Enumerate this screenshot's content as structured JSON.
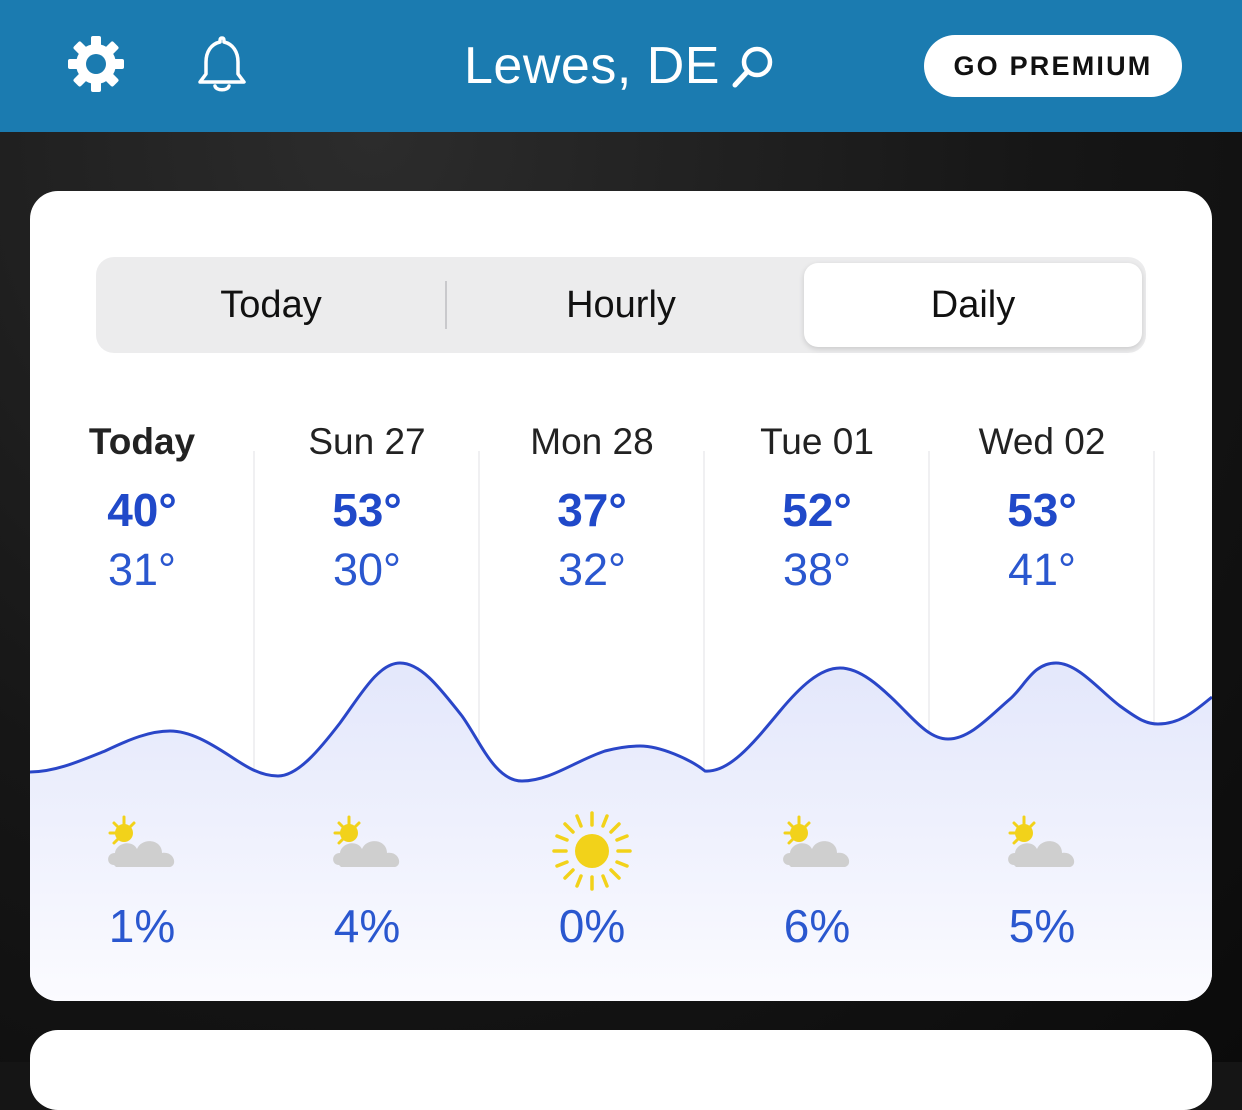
{
  "header": {
    "location": "Lewes, DE",
    "premium_label": "GO PREMIUM",
    "icons": [
      "gear-icon",
      "bell-icon",
      "search-icon"
    ]
  },
  "tabs": [
    {
      "label": "Today",
      "selected": false
    },
    {
      "label": "Hourly",
      "selected": false
    },
    {
      "label": "Daily",
      "selected": true
    }
  ],
  "days": [
    {
      "label": "Today",
      "high": "40°",
      "low": "31°",
      "icon": "partly-cloudy-icon",
      "precip": "1%"
    },
    {
      "label": "Sun 27",
      "high": "53°",
      "low": "30°",
      "icon": "partly-cloudy-icon",
      "precip": "4%"
    },
    {
      "label": "Mon 28",
      "high": "37°",
      "low": "32°",
      "icon": "sunny-icon",
      "precip": "0%"
    },
    {
      "label": "Tue 01",
      "high": "52°",
      "low": "38°",
      "icon": "partly-cloudy-icon",
      "precip": "6%"
    },
    {
      "label": "Wed 02",
      "high": "53°",
      "low": "41°",
      "icon": "partly-cloudy-icon",
      "precip": "5%"
    }
  ],
  "colors": {
    "header_bg": "#1b7bb0",
    "temp_high": "#2049c9",
    "temp_low": "#2a57cf",
    "line": "#2a46c8",
    "fill": "#e6e9fb",
    "sun": "#f2d21a",
    "cloud": "#cfcfcf"
  }
}
